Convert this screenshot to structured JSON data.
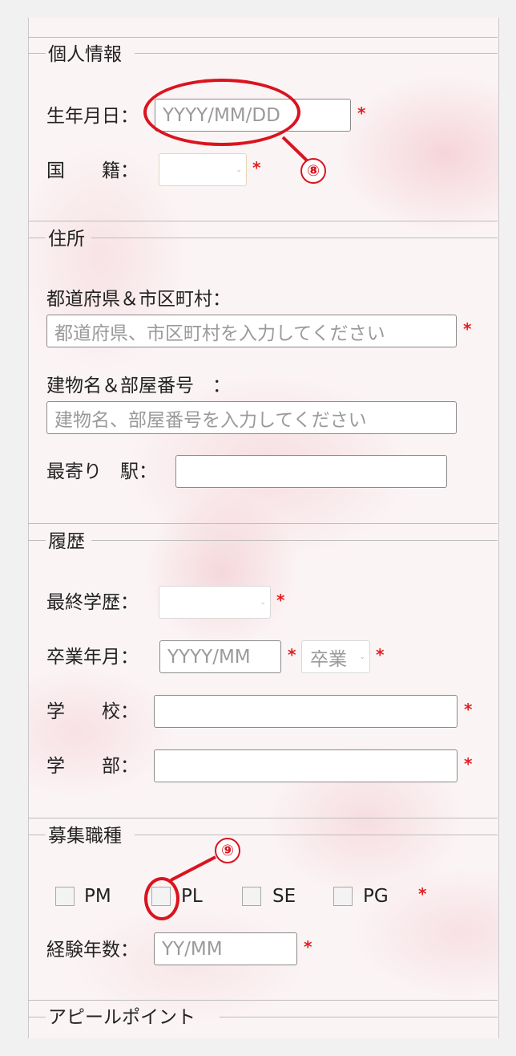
{
  "sections": {
    "personal": {
      "legend": "個人情報",
      "birthdate_label": "生年月日：",
      "birthdate_placeholder": "YYYY/MM/DD",
      "nationality_label": "国　　籍：",
      "nationality_value": ""
    },
    "address": {
      "legend": "住所",
      "pref_city_label": "都道府県＆市区町村：",
      "pref_city_placeholder": "都道府県、市区町村を入力してください",
      "building_label": "建物名＆部屋番号　：",
      "building_placeholder": "建物名、部屋番号を入力してください",
      "station_label": "最寄り　駅：",
      "station_value": ""
    },
    "history": {
      "legend": "履歴",
      "education_label": "最終学歴：",
      "education_value": "",
      "grad_label": "卒業年月：",
      "grad_placeholder": "YYYY/MM",
      "grad_status_value": "卒業",
      "school_label": "学　　校：",
      "school_value": "",
      "faculty_label": "学　　部：",
      "faculty_value": ""
    },
    "job": {
      "legend": "募集職種",
      "options": [
        "PM",
        "PL",
        "SE",
        "PG"
      ],
      "experience_label": "経験年数：",
      "experience_placeholder": "YY/MM"
    },
    "appeal": {
      "legend": "アピールポイント"
    }
  },
  "required_mark": "*",
  "annotations": [
    "⑧",
    "⑨"
  ],
  "colors": {
    "required": "#e02020",
    "annotation": "#d9141f",
    "panel_bg": "#fbf4f5"
  },
  "icons": [
    "dropdown-caret-icon",
    "checkbox-icon"
  ]
}
